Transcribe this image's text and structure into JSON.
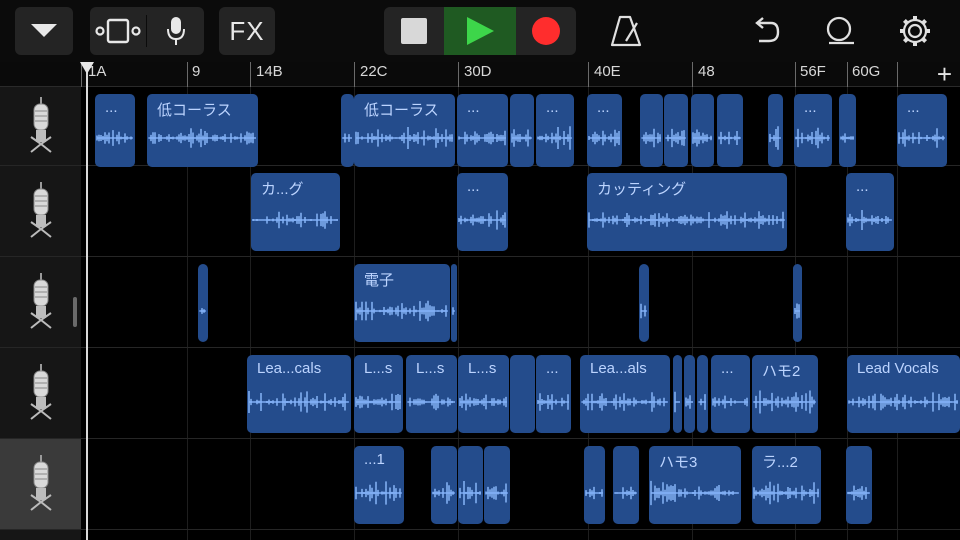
{
  "toolbar": {
    "menu_icon": "chevron-down-icon",
    "views_icon": "tracks-view-icon",
    "mic_icon": "microphone-icon",
    "fx_label": "FX",
    "stop_icon": "stop-icon",
    "play_icon": "play-icon",
    "record_icon": "record-icon",
    "metronome_icon": "metronome-icon",
    "undo_icon": "undo-icon",
    "loop_icon": "loop-browser-icon",
    "settings_icon": "gear-icon",
    "play_color": "#3dd64a",
    "record_color": "#ff2d2d"
  },
  "ruler": {
    "markers": [
      "1A",
      "9",
      "14B",
      "22C",
      "30D",
      "40E",
      "48",
      "56F",
      "60G"
    ],
    "add_label": "+"
  },
  "track_icons": [
    "microphone-icon",
    "microphone-icon",
    "microphone-icon",
    "microphone-icon",
    "microphone-icon"
  ],
  "selected_track": 4,
  "region_color": "#244c8c",
  "tracks": [
    {
      "regions": [
        "...",
        "低コーラス",
        "",
        "低コーラス",
        "...",
        "",
        "...",
        "...",
        "",
        "",
        "",
        "",
        "",
        "...",
        "",
        "..."
      ]
    },
    {
      "regions": [
        "カ...グ",
        "...",
        "カッティング",
        "..."
      ]
    },
    {
      "regions": [
        "",
        "電子",
        "",
        "",
        ""
      ]
    },
    {
      "regions": [
        "Lea...cals",
        "L...s",
        "L...s",
        "L...s",
        "",
        "...",
        "Lea...als",
        "",
        "",
        "",
        "...",
        "ハモ2",
        "Lead Vocals"
      ]
    },
    {
      "regions": [
        "...1",
        "",
        "",
        "",
        "",
        "",
        "ハモ3",
        "ラ...2",
        ""
      ]
    }
  ]
}
